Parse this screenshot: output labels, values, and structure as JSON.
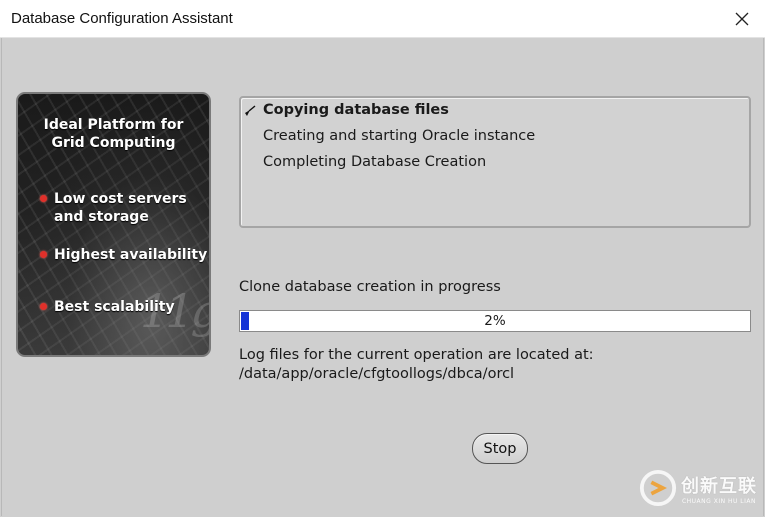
{
  "window": {
    "title": "Database Configuration Assistant"
  },
  "promo": {
    "title": "Ideal Platform for\nGrid Computing",
    "bullets": [
      "Low cost servers\nand storage",
      "Highest availability",
      "Best scalability"
    ],
    "watermark": "11g"
  },
  "steps": [
    {
      "label": "Copying database files",
      "state": "current"
    },
    {
      "label": "Creating and starting Oracle instance",
      "state": "pending"
    },
    {
      "label": "Completing Database Creation",
      "state": "pending"
    }
  ],
  "progress": {
    "label": "Clone database creation in progress",
    "percent_text": "2%",
    "value": 0.02,
    "fill_color": "#1433d6"
  },
  "log": {
    "line1": "Log files for the current operation are located at:",
    "line2": "/data/app/oracle/cfgtoollogs/dbca/orcl"
  },
  "buttons": {
    "stop": "Stop"
  },
  "watermark": {
    "cn": "创新互联",
    "en": "CHUANG XIN HU LIAN"
  }
}
